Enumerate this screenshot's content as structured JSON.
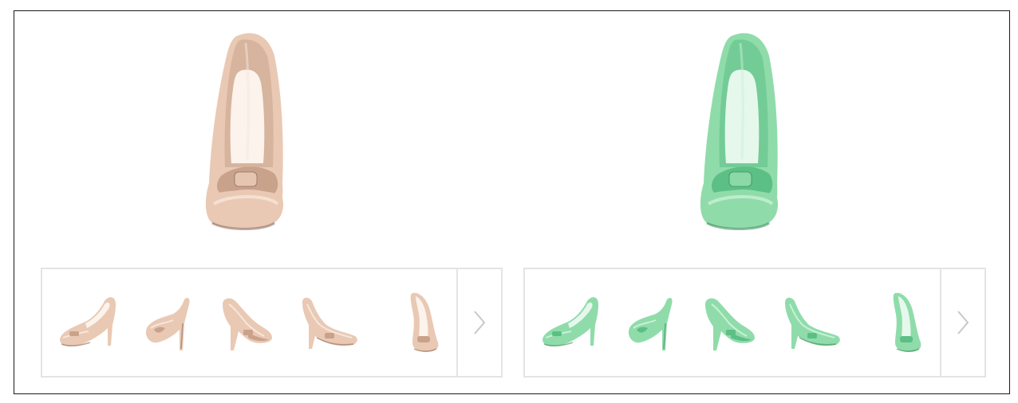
{
  "products": [
    {
      "id": "nude",
      "colors": {
        "base": "#e9c9b4",
        "shade": "#c9a28c",
        "dark": "#8c6a5a",
        "light": "#f7e6da",
        "lining": "#fbf3ec"
      },
      "main_image_alt": "nude-pump-front-view",
      "thumbnails": [
        {
          "view": "side-left"
        },
        {
          "view": "back-three-quarter"
        },
        {
          "view": "heel-angle"
        },
        {
          "view": "side-right"
        },
        {
          "view": "front-angle"
        }
      ],
      "next_icon": "chevron-right-icon"
    },
    {
      "id": "mint",
      "colors": {
        "base": "#8fdcaa",
        "shade": "#5cbf85",
        "dark": "#3c8a5c",
        "light": "#c9f0d6",
        "lining": "#e6f8ec"
      },
      "main_image_alt": "mint-pump-front-view",
      "thumbnails": [
        {
          "view": "side-left"
        },
        {
          "view": "back-three-quarter"
        },
        {
          "view": "heel-angle"
        },
        {
          "view": "side-right"
        },
        {
          "view": "front-angle"
        }
      ],
      "next_icon": "chevron-right-icon"
    }
  ]
}
